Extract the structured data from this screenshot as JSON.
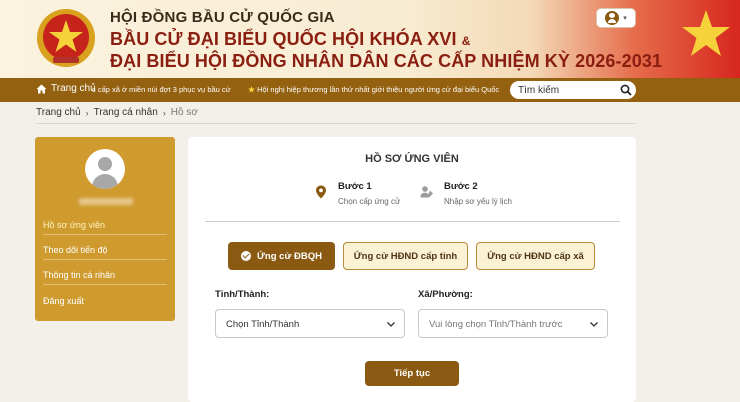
{
  "header": {
    "org": "HỘI ĐỒNG BẦU CỬ QUỐC GIA",
    "title_line1": "BẦU CỬ ĐẠI BIỂU QUỐC HỘI KHÓA XVI",
    "title_amp": "&",
    "title_line2": "ĐẠI BIỂU HỘI ĐỒNG NHÂN DÂN CÁC CẤP NHIỆM KỲ 2026-2031",
    "user_icon": "user-icon",
    "user_caret": "▾"
  },
  "nav": {
    "home_label": "Trang chủ",
    "home_icon": "home-icon",
    "ticker_1": "c cấp xã ở miền núi đợt 3 phục vụ bầu cử",
    "ticker_2": "Hội nghị hiệp thương lần thứ nhất giới thiệu người ứng cử đại biểu Quốc",
    "search_placeholder": "Tìm kiếm",
    "search_icon": "search-icon"
  },
  "breadcrumb": {
    "items": [
      "Trang chủ",
      "Trang cá nhân",
      "Hồ sơ"
    ],
    "separator": "›"
  },
  "sidebar": {
    "items": [
      {
        "label": "Hồ sơ ứng viên",
        "active": true
      },
      {
        "label": "Theo dõi tiến độ",
        "active": false
      },
      {
        "label": "Thông tin cá nhân",
        "active": false
      },
      {
        "label": "Đăng xuất",
        "active": false
      }
    ]
  },
  "main": {
    "title": "HỒ SƠ ỨNG VIÊN",
    "steps": [
      {
        "title": "Bước 1",
        "subtitle": "Chọn cấp ứng cử",
        "icon": "location-pin-icon"
      },
      {
        "title": "Bước 2",
        "subtitle": "Nhập sơ yếu lý lịch",
        "icon": "user-edit-icon"
      }
    ],
    "tabs": [
      {
        "label": "Ứng cử ĐBQH",
        "selected": true
      },
      {
        "label": "Ứng cử HĐND cấp tỉnh",
        "selected": false
      },
      {
        "label": "Ứng cử HĐND cấp xã",
        "selected": false
      }
    ],
    "province_label": "Tỉnh/Thành:",
    "province_value": "Chọn Tỉnh/Thành",
    "ward_label": "Xã/Phường:",
    "ward_placeholder": "Vui lòng chọn Tỉnh/Thành trước",
    "submit_label": "Tiếp tục"
  },
  "colors": {
    "primary_brown": "#8b5a12",
    "nav_bar": "#93610f",
    "sidebar_gold": "#cf9b2f",
    "title_red": "#8a1e10",
    "tab_light": "#fbf1d4"
  }
}
